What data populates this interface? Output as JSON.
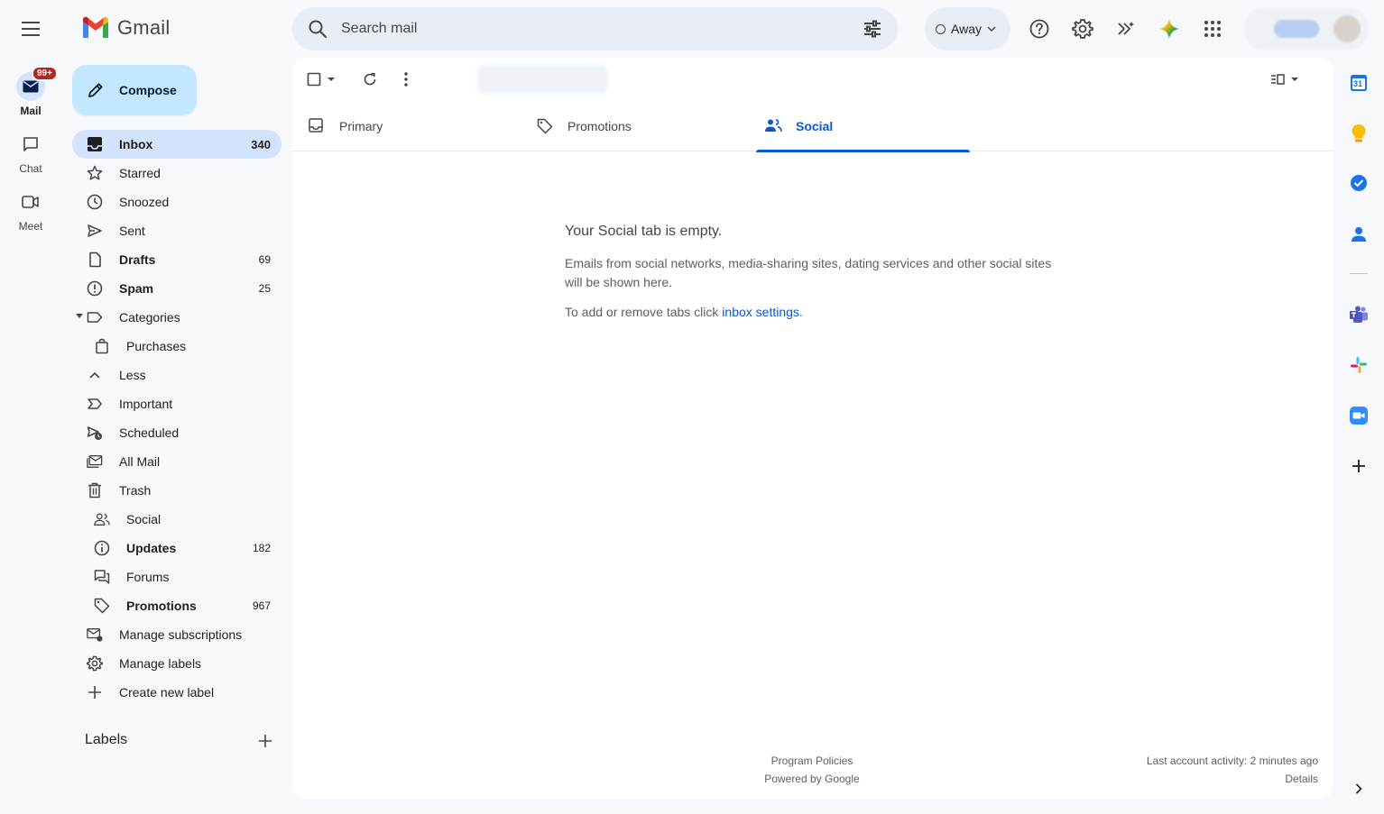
{
  "app": {
    "logo_text": "Gmail"
  },
  "rail": {
    "items": [
      {
        "label": "Mail",
        "badge": "99+"
      },
      {
        "label": "Chat"
      },
      {
        "label": "Meet"
      }
    ]
  },
  "search": {
    "placeholder": "Search mail"
  },
  "status": {
    "label": "Away"
  },
  "compose": {
    "label": "Compose"
  },
  "nav": {
    "items": [
      {
        "label": "Inbox",
        "count": "340"
      },
      {
        "label": "Starred",
        "count": ""
      },
      {
        "label": "Snoozed",
        "count": ""
      },
      {
        "label": "Sent",
        "count": ""
      },
      {
        "label": "Drafts",
        "count": "69"
      },
      {
        "label": "Spam",
        "count": "25"
      },
      {
        "label": "Categories",
        "count": ""
      },
      {
        "label": "Purchases",
        "count": ""
      },
      {
        "label": "Less",
        "count": ""
      },
      {
        "label": "Important",
        "count": ""
      },
      {
        "label": "Scheduled",
        "count": ""
      },
      {
        "label": "All Mail",
        "count": ""
      },
      {
        "label": "Trash",
        "count": ""
      },
      {
        "label": "Social",
        "count": ""
      },
      {
        "label": "Updates",
        "count": "182"
      },
      {
        "label": "Forums",
        "count": ""
      },
      {
        "label": "Promotions",
        "count": "967"
      },
      {
        "label": "Manage subscriptions",
        "count": ""
      },
      {
        "label": "Manage labels",
        "count": ""
      },
      {
        "label": "Create new label",
        "count": ""
      }
    ]
  },
  "labels": {
    "header": "Labels"
  },
  "tabs": [
    {
      "label": "Primary"
    },
    {
      "label": "Promotions"
    },
    {
      "label": "Social"
    }
  ],
  "empty": {
    "title": "Your Social tab is empty.",
    "description": "Emails from social networks, media-sharing sites, dating services and other social sites will be shown here.",
    "hint_prefix": "To add or remove tabs click ",
    "hint_link": "inbox settings",
    "hint_suffix": "."
  },
  "footer": {
    "program_policies": "Program Policies",
    "powered_by": "Powered by Google",
    "last_activity": "Last account activity: 2 minutes ago",
    "details": "Details"
  },
  "side_panel": {
    "calendar_day": "31"
  },
  "colors": {
    "accent": "#0b57d0",
    "compose_bg": "#c2e7ff",
    "active_nav_bg": "#d3e3fd",
    "badge": "#b3261e",
    "page_bg": "#f6f8fc"
  }
}
